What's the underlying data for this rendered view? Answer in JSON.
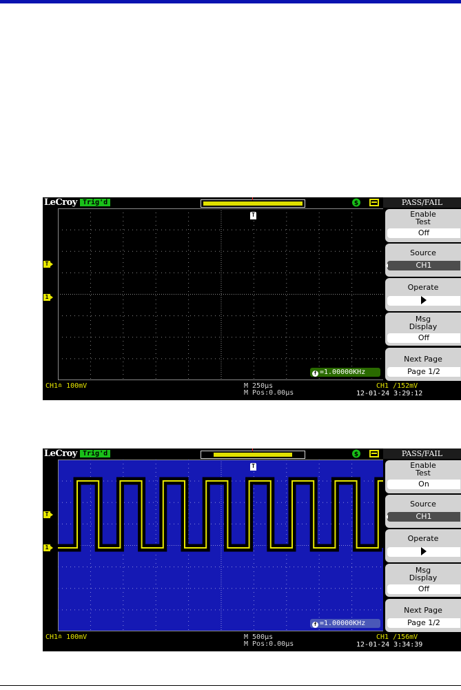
{
  "screens": [
    {
      "brand": "LeCroy",
      "trig_state": "Trig'd",
      "menu_title": "PASS/FAIL",
      "menu": {
        "enable_label_1": "Enable",
        "enable_label_2": "Test",
        "enable_value": "Off",
        "source_label": "Source",
        "source_value": "CH1",
        "operate_label": "Operate",
        "msg_label_1": "Msg",
        "msg_label_2": "Display",
        "msg_value": "Off",
        "next_label": "Next Page",
        "next_value": "Page 1/2"
      },
      "channel_marker": "1",
      "trigger_marker": "T",
      "frequency": "=1.00000KHz",
      "ch1_scale": "CH1≐ 100mV",
      "timebase": "M 250μs",
      "mpos": "M Pos:0.00μs",
      "trigger_info": "CH1 ∕152mV",
      "datetime": "12-01-24 3:29:12",
      "waveform": "none",
      "graticule_color": "#000000"
    },
    {
      "brand": "LeCroy",
      "trig_state": "Trig'd",
      "menu_title": "PASS/FAIL",
      "menu": {
        "enable_label_1": "Enable",
        "enable_label_2": "Test",
        "enable_value": "On",
        "source_label": "Source",
        "source_value": "CH1",
        "operate_label": "Operate",
        "msg_label_1": "Msg",
        "msg_label_2": "Display",
        "msg_value": "Off",
        "next_label": "Next Page",
        "next_value": "Page 1/2"
      },
      "channel_marker": "1",
      "trigger_marker": "T",
      "frequency": "=1.00000KHz",
      "ch1_scale": "CH1≐ 100mV",
      "timebase": "M 500μs",
      "mpos": "M Pos:0.00μs",
      "trigger_info": "CH1 ∕156mV",
      "datetime": "12-01-24 3:34:39",
      "waveform": "square",
      "graticule_color": "#1519b4"
    }
  ]
}
